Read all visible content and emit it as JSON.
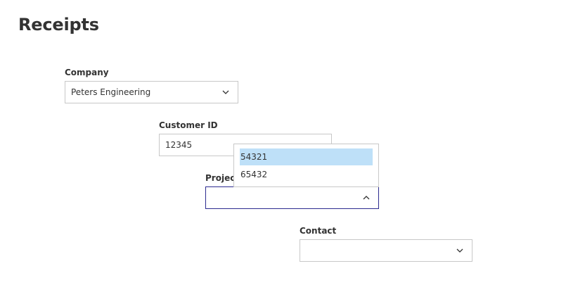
{
  "page": {
    "title": "Receipts"
  },
  "company": {
    "label": "Company",
    "value": "Peters Engineering"
  },
  "customer_id": {
    "label": "Customer ID",
    "value": "12345"
  },
  "project": {
    "label": "Project",
    "value": "",
    "options": [
      {
        "label": "54321",
        "highlighted": true
      },
      {
        "label": "65432",
        "highlighted": false
      }
    ]
  },
  "contact": {
    "label": "Contact",
    "value": ""
  },
  "colors": {
    "highlight": "#bee0f8",
    "active_border": "#2c2a8f",
    "border": "#c8c8c8"
  }
}
